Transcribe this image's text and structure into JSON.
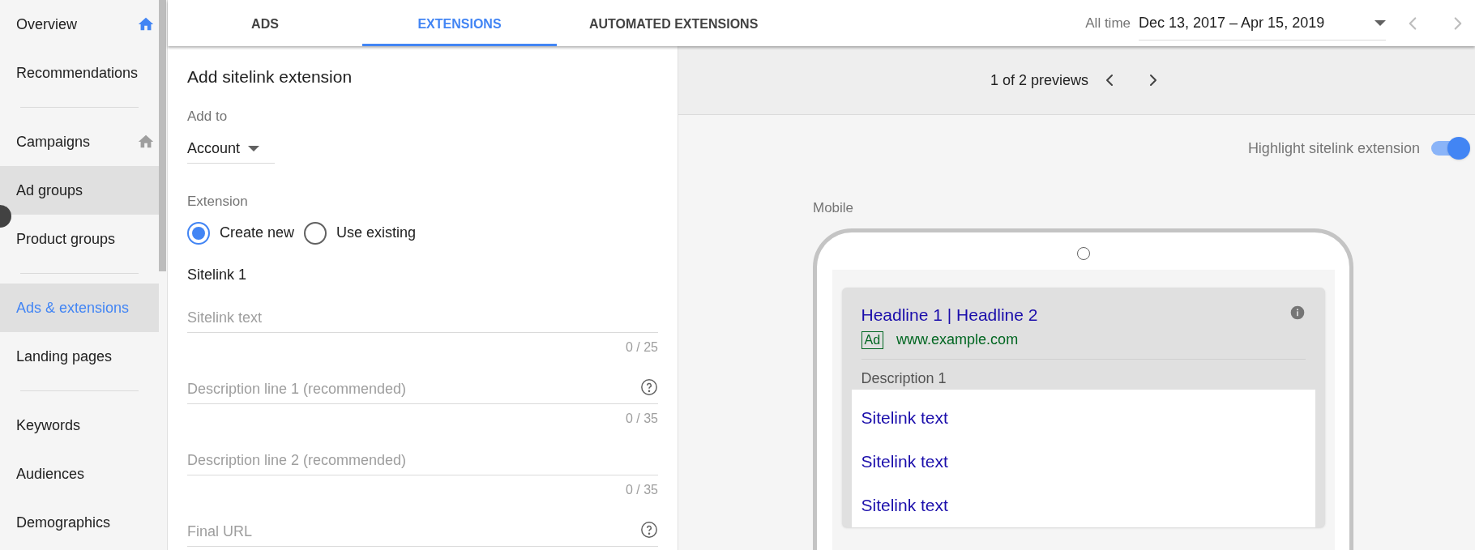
{
  "sidebar": {
    "items": [
      {
        "kind": "item",
        "label": "Overview",
        "selected": false
      },
      {
        "kind": "item",
        "label": "Recommendations",
        "selected": false
      },
      {
        "kind": "divider"
      },
      {
        "kind": "item",
        "label": "Campaigns",
        "selected": false
      },
      {
        "kind": "item",
        "label": "Ad groups",
        "selected": false,
        "hovered": true
      },
      {
        "kind": "item",
        "label": "Product groups",
        "selected": false
      },
      {
        "kind": "divider"
      },
      {
        "kind": "item",
        "label": "Ads & extensions",
        "selected": true
      },
      {
        "kind": "item",
        "label": "Landing pages",
        "selected": false
      },
      {
        "kind": "divider"
      },
      {
        "kind": "item",
        "label": "Keywords",
        "selected": false
      },
      {
        "kind": "item",
        "label": "Audiences",
        "selected": false
      },
      {
        "kind": "item",
        "label": "Demographics",
        "selected": false
      }
    ]
  },
  "tabs": [
    {
      "label": "ADS",
      "selected": false
    },
    {
      "label": "EXTENSIONS",
      "selected": true
    },
    {
      "label": "AUTOMATED EXTENSIONS",
      "selected": false
    }
  ],
  "date_range": {
    "label": "All time",
    "value": "Dec 13, 2017 – Apr 15, 2019"
  },
  "form": {
    "title": "Add sitelink extension",
    "add_to": {
      "label": "Add to",
      "value": "Account"
    },
    "extension": {
      "label": "Extension",
      "options": [
        {
          "label": "Create new",
          "selected": true
        },
        {
          "label": "Use existing",
          "selected": false
        }
      ]
    },
    "section": "Sitelink 1",
    "fields": [
      {
        "placeholder": "Sitelink text",
        "counter": "0 / 25",
        "help": false
      },
      {
        "placeholder": "Description line 1 (recommended)",
        "counter": "0 / 35",
        "help": true
      },
      {
        "placeholder": "Description line 2 (recommended)",
        "counter": "0 / 35",
        "help": false
      },
      {
        "placeholder": "Final URL",
        "help": true
      }
    ]
  },
  "preview": {
    "pager": "1 of 2 previews",
    "highlight": {
      "label": "Highlight sitelink extension",
      "on": true
    },
    "device": "Mobile",
    "ad": {
      "headline": "Headline 1 | Headline 2",
      "badge": "Ad",
      "url": "www.example.com",
      "description": "Description 1",
      "sitelinks": [
        "Sitelink text",
        "Sitelink text",
        "Sitelink text"
      ]
    }
  }
}
